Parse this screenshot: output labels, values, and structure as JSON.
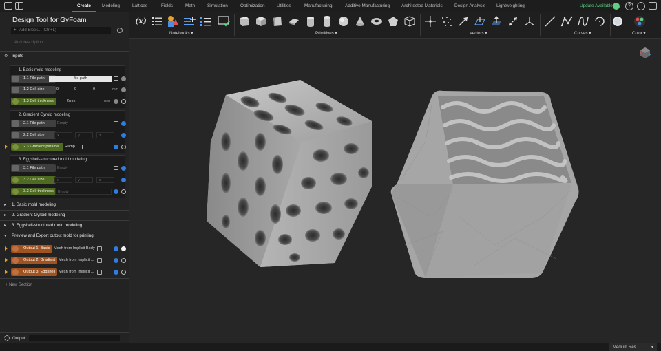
{
  "menubar": {
    "tabs": [
      "Create",
      "Modeling",
      "Lattices",
      "Fields",
      "Math",
      "Simulation",
      "Optimization",
      "Utilities",
      "Manufacturing",
      "Additive Manufacturing",
      "Architected Materials",
      "Design Analysis",
      "Lightweighting"
    ],
    "active_tab": "Create",
    "update_label": "Update Available"
  },
  "panel": {
    "title": "Design Tool for GyFoam",
    "add_block_placeholder": "Add Block... (Ctrl+L)",
    "add_description": "Add description...",
    "inputs_label": "Inputs",
    "groups": [
      {
        "label": "1. Basic mold modeling",
        "rows": [
          {
            "label": "1.1 File path",
            "value": "file path"
          },
          {
            "label": "1.2 Cell size",
            "x": "9",
            "y": "9",
            "z": "9",
            "unit": "mm"
          },
          {
            "label": "1.3 Cell thickness",
            "value": "2mm",
            "unit": "mm"
          }
        ]
      },
      {
        "label": "2. Gradient Gyroid modeling",
        "rows": [
          {
            "label": "2.1 File path",
            "value": "Empty"
          },
          {
            "label": "2.2 Cell size",
            "x": "x",
            "y": "y",
            "z": "z"
          },
          {
            "label": "2.3 Gradient parame...",
            "value": "Ramp"
          }
        ]
      },
      {
        "label": "3. Eggshell-structured mold modeling",
        "rows": [
          {
            "label": "3.1 File path",
            "value": "Empty"
          },
          {
            "label": "3.2 Cell size",
            "x": "x",
            "y": "y",
            "z": "z"
          },
          {
            "label": "3.3 Cell thickness",
            "value": "Empty"
          }
        ]
      }
    ],
    "sections": [
      "1. Basic mold modeling",
      "2. Gradient Gyroid modeling",
      "3. Eggshell-structured mold modeling",
      "Preview and Export output mold for printing"
    ],
    "outputs": [
      {
        "label": "Output 1: Basic",
        "value": "Mesh from Implicit Body"
      },
      {
        "label": "Output 2: Gradient",
        "value": "Mesh from Implicit ..."
      },
      {
        "label": "Output 3: Eggshell",
        "value": "Mesh from Implicit ..."
      }
    ],
    "new_section": "New Section",
    "output_label": "Output:"
  },
  "toolbar": {
    "groups": [
      {
        "label": "Notebooks"
      },
      {
        "label": "Primitives"
      },
      {
        "label": "Vectors"
      },
      {
        "label": "Curves"
      },
      {
        "label": "Color"
      }
    ],
    "variable_icon_text": "(x)"
  },
  "status": {
    "resolution": "Medium Res"
  },
  "colors": {
    "accent": "#2f7de1",
    "input_green": "#4f6b22",
    "output_orange": "#a0521f",
    "update_green": "#5fcf80"
  }
}
